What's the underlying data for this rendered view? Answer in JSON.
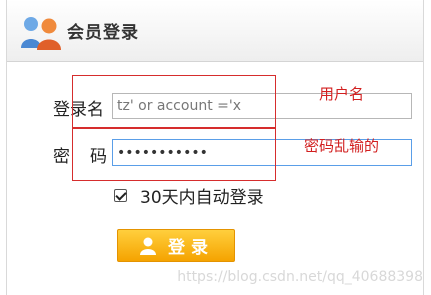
{
  "header": {
    "title": "会员登录",
    "icon": "users-icon"
  },
  "form": {
    "username_label": "登录名",
    "username_value": "tz' or account ='x",
    "password_label_a": "密",
    "password_label_b": "码",
    "password_value": "•••••••••••",
    "remember_label": "30天内自动登录",
    "remember_checked": true,
    "login_label": "登录",
    "login_icon": "user-icon"
  },
  "annotations": {
    "username_note": "用户名",
    "password_note": "密码乱输的"
  },
  "watermark": "https://blog.csdn.net/qq_40688398",
  "colors": {
    "accent_button": "#f5a300",
    "annotation_red": "#d62d2d",
    "focus_border": "#5a9ee8"
  }
}
